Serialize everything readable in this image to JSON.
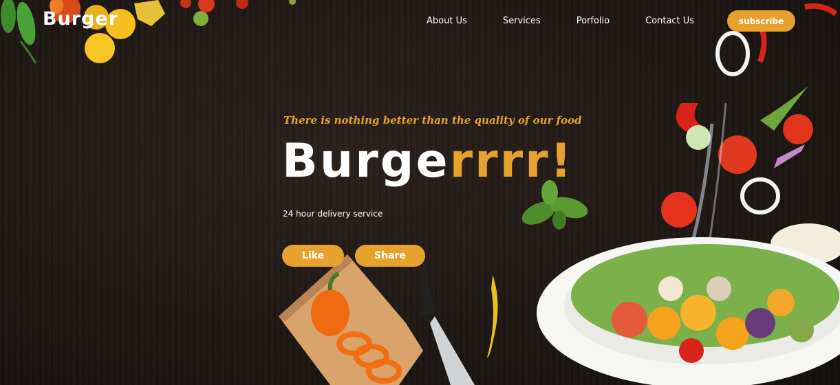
{
  "brand": {
    "logo": "Burger"
  },
  "nav": {
    "items": [
      "About Us",
      "Services",
      "Porfolio",
      "Contact Us"
    ],
    "subscribe_label": "subscribe"
  },
  "hero": {
    "tagline": "There is nothing better than the quality of our food",
    "title_white": "Burge",
    "title_accent": "rrrr!",
    "subtitle": "24 hour delivery service",
    "like_label": "Like",
    "share_label": "Share"
  },
  "colors": {
    "accent": "#e7a12f",
    "background": "#1e1714",
    "text": "#ffffff"
  }
}
